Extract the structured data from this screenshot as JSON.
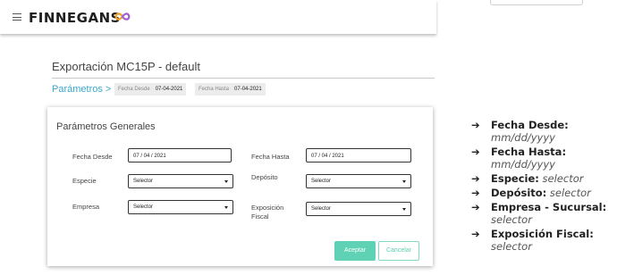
{
  "header": {
    "brand": "FINNEGANS",
    "menu_icon": "hamburger-menu-icon",
    "logo_icon": "infinity-logo-icon",
    "logo_colors": {
      "left": "#f0a226",
      "right": "#9b5fd0"
    }
  },
  "page": {
    "title": "Exportación MC15P - default"
  },
  "breadcrumb": {
    "label": "Parámetros >",
    "chips": [
      {
        "label": "Fecha Desde",
        "value": "07-04-2021"
      },
      {
        "label": "Fecha Hasta",
        "value": "07-04-2021"
      }
    ]
  },
  "dialog": {
    "title": "Parámetros Generales",
    "fields": {
      "fecha_desde": {
        "label": "Fecha Desde",
        "value": "07 / 04 / 2021"
      },
      "fecha_hasta": {
        "label": "Fecha Hasta",
        "value": "07 / 04 / 2021"
      },
      "especie": {
        "label": "Especie",
        "value": "Selector"
      },
      "deposito": {
        "label": "Depósito",
        "value": "Selector"
      },
      "empresa": {
        "label": "Empresa",
        "value": "Selector"
      },
      "exposicion": {
        "label": "Exposición\nFiscal",
        "value": "Selector"
      }
    },
    "buttons": {
      "accept": "Aceptar",
      "cancel": "Cancelar"
    }
  },
  "notes": [
    {
      "arrow": "➔",
      "key": "Fecha Desde:",
      "value": "mm/dd/yyyy"
    },
    {
      "arrow": "➔",
      "key": "Fecha Hasta:",
      "value": "mm/dd/yyyy"
    },
    {
      "arrow": "➔",
      "key": "Especie:",
      "value": "selector"
    },
    {
      "arrow": "➔",
      "key": "Depósito:",
      "value": "selector"
    },
    {
      "arrow": "➔",
      "key": "Empresa - Sucursal:",
      "value": "selector"
    },
    {
      "arrow": "➔",
      "key": "Exposición Fiscal:",
      "value": "selector"
    }
  ],
  "colors": {
    "accent": "#3aa7c8",
    "accept": "#5fd1b4"
  }
}
